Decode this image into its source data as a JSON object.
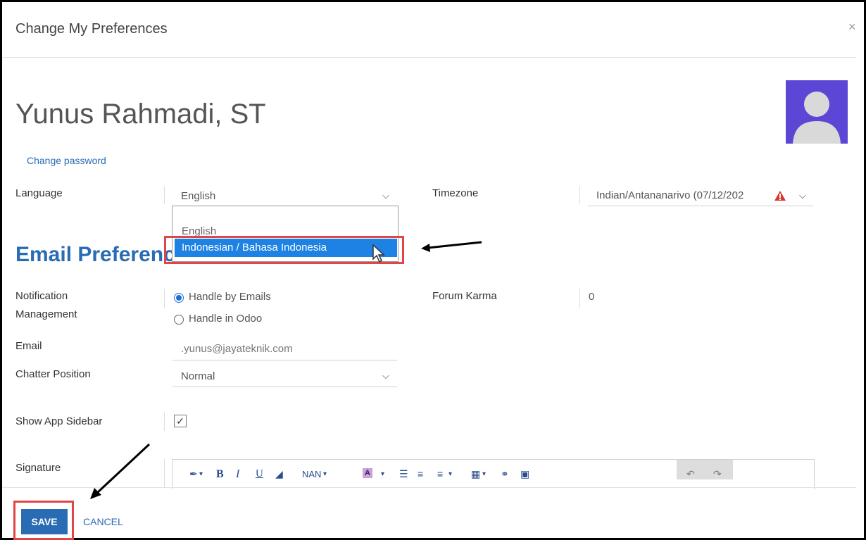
{
  "dialog": {
    "title": "Change My Preferences",
    "close_glyph": "×"
  },
  "user": {
    "name": "Yunus Rahmadi, ST",
    "change_password": "Change password"
  },
  "fields": {
    "language": {
      "label": "Language",
      "value": "English"
    },
    "timezone": {
      "label": "Timezone",
      "value": "Indian/Antananarivo (07/12/202"
    },
    "language_options": [
      "English",
      "Indonesian / Bahasa Indonesia"
    ],
    "section_title": "Email Preferences",
    "notification": {
      "label_line1": "Notification",
      "label_line2": "Management",
      "options": [
        "Handle by Emails",
        "Handle in Odoo"
      ],
      "selected": 0
    },
    "forum_karma": {
      "label": "Forum Karma",
      "value": "0"
    },
    "email": {
      "label": "Email",
      "value": ".yunus@jayateknik.com"
    },
    "chatter": {
      "label": "Chatter Position",
      "value": "Normal"
    },
    "sidebar": {
      "label": "Show App Sidebar",
      "checked": true
    },
    "signature": {
      "label": "Signature"
    }
  },
  "toolbar": {
    "style_glyph": "✒",
    "bold": "B",
    "italic": "I",
    "underline": "U",
    "eraser": "◢",
    "font": "NAN",
    "color": "A",
    "caret": "▾",
    "ul": "☰",
    "ol": "≡",
    "align": "≡",
    "table": "▦",
    "link": "⚭",
    "image": "▣",
    "undo": "↶",
    "redo": "↷"
  },
  "footer": {
    "save": "SAVE",
    "cancel": "CANCEL"
  },
  "colors": {
    "accent": "#2a6cb3",
    "highlight": "#1e82e5",
    "annotation": "#e04646"
  }
}
